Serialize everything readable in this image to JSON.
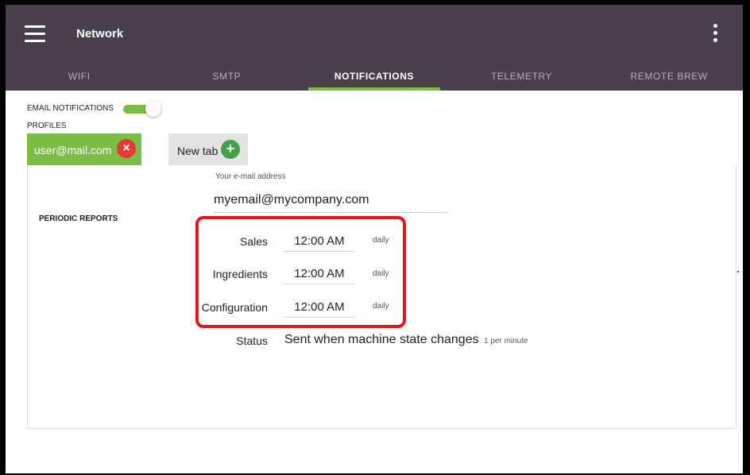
{
  "app": {
    "title": "Network"
  },
  "tabs": [
    {
      "label": "WIFI",
      "active": false
    },
    {
      "label": "SMTP",
      "active": false
    },
    {
      "label": "NOTIFICATIONS",
      "active": true
    },
    {
      "label": "TELEMETRY",
      "active": false
    },
    {
      "label": "REMOTE BREW",
      "active": false
    }
  ],
  "notifications": {
    "email_notifications_label": "EMAIL NOTIFICATIONS",
    "email_notifications_enabled": true,
    "profiles_label": "PROFILES",
    "profile_tabs": [
      {
        "label": "user@mail.com",
        "action_icon": "close-icon"
      },
      {
        "label": "New tab",
        "action_icon": "plus-icon"
      }
    ],
    "email_field": {
      "label": "Your e-mail address",
      "value": "myemail@mycompany.com"
    },
    "periodic_reports_label": "PERIODIC REPORTS",
    "reports": [
      {
        "label": "Sales",
        "time": "12:00 AM",
        "frequency": "daily"
      },
      {
        "label": "Ingredients",
        "time": "12:00 AM",
        "frequency": "daily"
      },
      {
        "label": "Configuration",
        "time": "12:00 AM",
        "frequency": "daily"
      }
    ],
    "status": {
      "label": "Status",
      "value": "Sent when machine state changes",
      "rate": "1 per minute"
    }
  },
  "colors": {
    "app_bar": "#4a3f4d",
    "accent_green": "#7cbd45",
    "close_red": "#e53935",
    "add_green": "#43a047",
    "highlight_red": "#e8131d"
  },
  "icons": {
    "menu": "hamburger-icon",
    "more": "more-vert-icon",
    "close": "close-icon",
    "add": "plus-icon"
  }
}
